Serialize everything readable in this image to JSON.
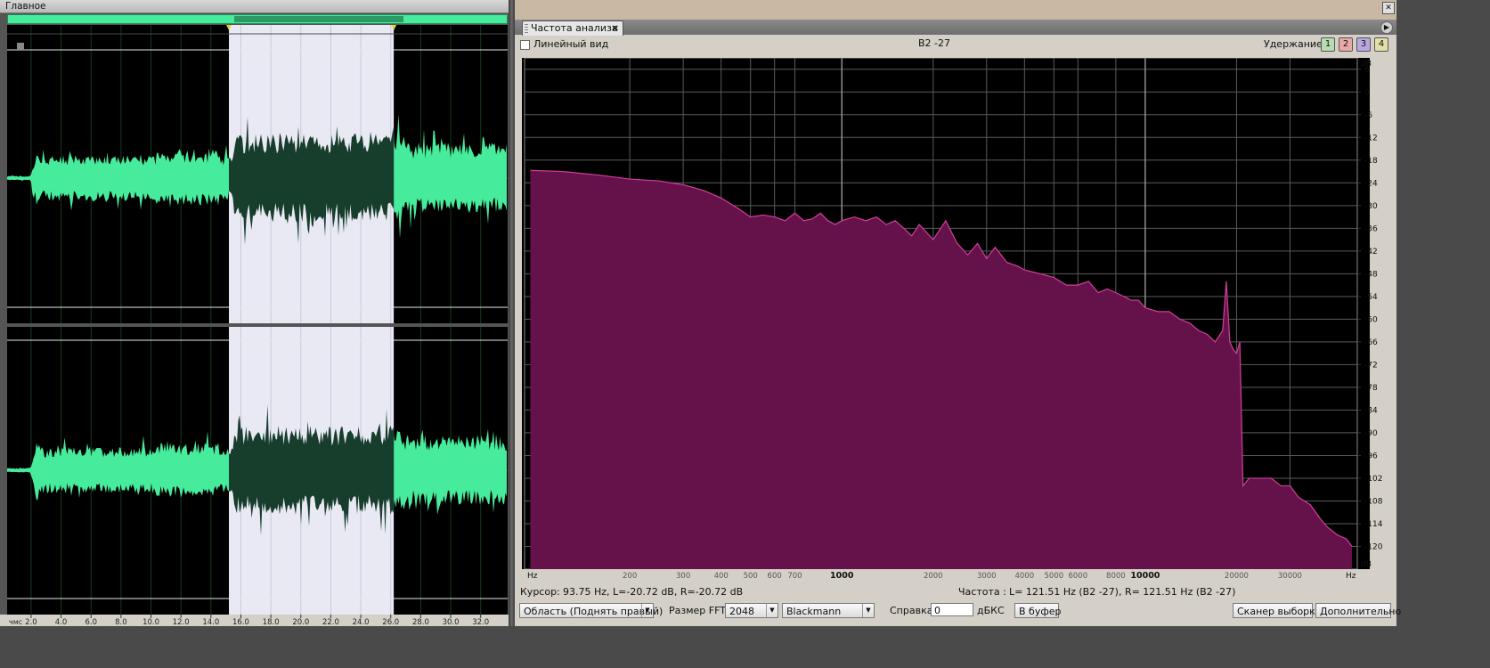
{
  "left_panel": {
    "title": "Главное",
    "time_unit": "чмс",
    "time_ticks": [
      "2.0",
      "4.0",
      "6.0",
      "8.0",
      "10.0",
      "12.0",
      "14.0",
      "16.0",
      "18.0",
      "20.0",
      "22.0",
      "24.0",
      "26.0",
      "28.0",
      "30.0",
      "32.0"
    ],
    "selection": {
      "start": 15.2,
      "end": 26.2
    },
    "colors": {
      "waveform": "#47eb9c",
      "waveform_selected": "#173d2c",
      "selection_bg": "#e9e9f4",
      "background": "#000000"
    }
  },
  "analysis_panel": {
    "tab_title": "Частота  анализа",
    "tab_close": "×",
    "linear_view_label": "Линейный вид",
    "linear_view_checked": false,
    "center_text": "B2 -27",
    "hold_label": "Удержание:",
    "hold_buttons": [
      {
        "label": "1",
        "color": "#b8dcb0"
      },
      {
        "label": "2",
        "color": "#e8a8a8"
      },
      {
        "label": "3",
        "color": "#b8a8e0"
      },
      {
        "label": "4",
        "color": "#e0e0a8"
      }
    ],
    "x_unit_left": "Hz",
    "x_unit_right": "Hz",
    "x_ticks": [
      "200",
      "300",
      "400",
      "500",
      "600",
      "700",
      "1000",
      "2000",
      "3000",
      "4000",
      "5000",
      "6000",
      "8000",
      "10000",
      "20000",
      "30000"
    ],
    "x_ticks_bold": [
      "1000",
      "10000"
    ],
    "y_unit": "dB",
    "y_ticks": [
      "6",
      "0",
      "-6",
      "-12",
      "-18",
      "-24",
      "-30",
      "-36",
      "-42",
      "-48",
      "-54",
      "-60",
      "-66",
      "-72",
      "-78",
      "-84",
      "-90",
      "-96",
      "-102",
      "-108",
      "-114",
      "-120"
    ],
    "y_unit_bottom": "dB",
    "status": {
      "cursor_label": "Курсор:",
      "cursor_value": "93.75 Hz, L=-20.72 dB, R=-20.72 dB",
      "freq_label": "Частота :",
      "freq_value": "L= 121.51 Hz (B2 -27), R= 121.51 Hz (B2 -27)"
    },
    "controls": {
      "area_select": "Область (Поднять правый)",
      "fft_label": "Размер FFT:",
      "fft_value": "2048",
      "window_value": "Blackmann",
      "ref_label": "Справка:",
      "ref_value": "0",
      "ref_unit": "дБКС",
      "to_buffer": "В буфер",
      "scanner": "Сканер выборки",
      "advanced": "Дополнительно"
    }
  },
  "chart_data": {
    "type": "area",
    "x_scale": "log",
    "xlim": [
      90,
      50000
    ],
    "ylim": [
      -126,
      9
    ],
    "fill_color": "#65114a",
    "line_color": "#d0409a",
    "series": [
      {
        "x": [
          94,
          120,
          160,
          200,
          250,
          300,
          350,
          400,
          450,
          500,
          550,
          600,
          650,
          700,
          750,
          800,
          850,
          900,
          950,
          1000,
          1100,
          1200,
          1300,
          1400,
          1500,
          1600,
          1700,
          1800,
          2000,
          2200,
          2400,
          2600,
          2800,
          3000,
          3200,
          3500,
          3800,
          4000,
          4500,
          5000,
          5500,
          6000,
          6500,
          7000,
          7500,
          8000,
          8500,
          9000,
          9500,
          10000,
          11000,
          12000,
          13000,
          14000,
          15000,
          16000,
          17000,
          18000,
          18500,
          19000,
          19500,
          20000,
          20500,
          21000,
          22000,
          24000,
          26000,
          28000,
          30000,
          32000,
          35000,
          38000,
          40000,
          43000,
          46000,
          48000
        ],
        "values": [
          -20.7,
          -21,
          -22,
          -23,
          -23.5,
          -24.5,
          -26,
          -28,
          -30.5,
          -33,
          -32.5,
          -33,
          -34,
          -32,
          -34,
          -33.5,
          -32,
          -34,
          -35,
          -34,
          -33,
          -34,
          -33,
          -35,
          -34,
          -36,
          -38,
          -35,
          -39,
          -34,
          -40,
          -43,
          -40,
          -44,
          -41,
          -45,
          -46,
          -47,
          -48,
          -49,
          -51,
          -51,
          -50,
          -53,
          -52,
          -53,
          -54,
          -55,
          -55,
          -57,
          -58,
          -58,
          -60,
          -61,
          -63,
          -64,
          -66,
          -63,
          -50,
          -66,
          -68,
          -69,
          -66,
          -104,
          -102,
          -102,
          -102,
          -104,
          -104,
          -107,
          -109,
          -113,
          -115,
          -117,
          -118,
          -120
        ]
      }
    ]
  }
}
